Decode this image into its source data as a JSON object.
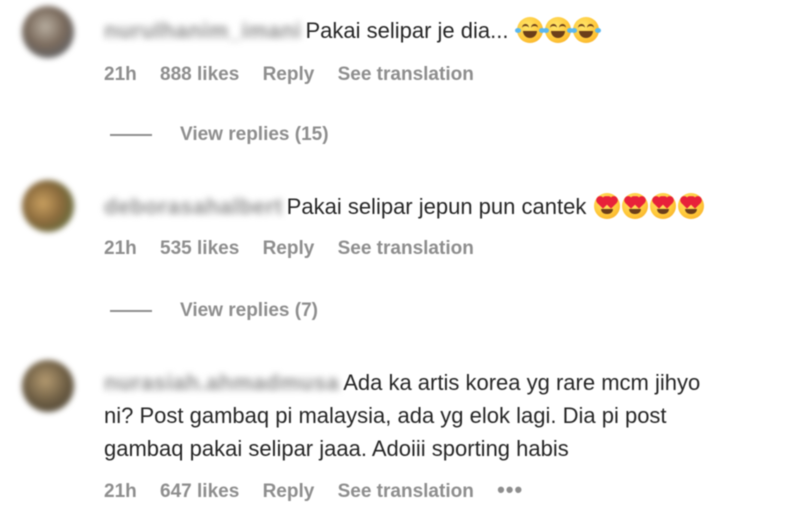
{
  "comments": [
    {
      "username": "nuruIhanim_imani",
      "text": "Pakai selipar je dia...",
      "emoji_icon": "face-with-tears-of-joy-icon",
      "emoji_count": 3,
      "time": "21h",
      "likes": "888 likes",
      "reply": "Reply",
      "translate": "See translation",
      "view_replies": "View replies (15)",
      "avatar_color": "#7a6a5c"
    },
    {
      "username": "deborasahalbert",
      "text": "Pakai selipar jepun pun cantek",
      "emoji_icon": "smiling-face-with-heart-eyes-icon",
      "emoji_count": 4,
      "time": "21h",
      "likes": "535 likes",
      "reply": "Reply",
      "translate": "See translation",
      "view_replies": "View replies (7)",
      "avatar_color": "#8a6a3c"
    },
    {
      "username": "nurasiah.ahmadmusa",
      "text_line1": "Ada ka artis korea yg rare mcm jihyo",
      "text_line2": "ni? Post gambaq pi malaysia, ada yg elok lagi. Dia pi post",
      "text_line3": "gambaq pakai selipar jaaa. Adoiii sporting habis",
      "time": "21h",
      "likes": "647 likes",
      "reply": "Reply",
      "translate": "See translation",
      "more": "•••",
      "avatar_color": "#6e5e44"
    }
  ]
}
